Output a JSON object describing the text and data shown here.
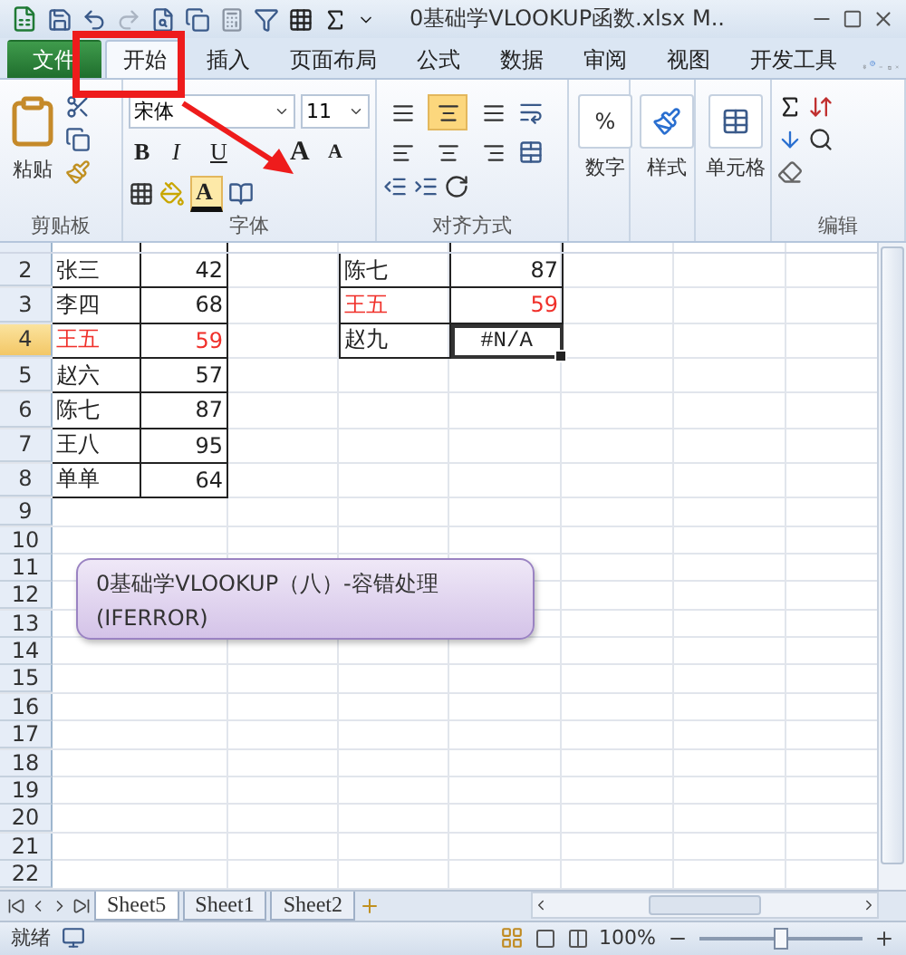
{
  "window": {
    "title": "0基础学VLOOKUP函数.xlsx M.."
  },
  "tabs": [
    {
      "label": "文件",
      "kind": "file",
      "selected": false
    },
    {
      "label": "开始",
      "kind": "tab",
      "selected": true
    },
    {
      "label": "插入",
      "kind": "tab",
      "selected": false
    },
    {
      "label": "页面布局",
      "kind": "tab",
      "selected": false
    },
    {
      "label": "公式",
      "kind": "tab",
      "selected": false
    },
    {
      "label": "数据",
      "kind": "tab",
      "selected": false
    },
    {
      "label": "审阅",
      "kind": "tab",
      "selected": false
    },
    {
      "label": "视图",
      "kind": "tab",
      "selected": false
    },
    {
      "label": "开发工具",
      "kind": "tab",
      "selected": false
    }
  ],
  "ribbon": {
    "clipboard": {
      "paste": "粘贴",
      "label": "剪贴板"
    },
    "font": {
      "font_name": "宋体",
      "font_size": "11",
      "style_buttons": [
        "B",
        "I",
        "U"
      ],
      "size_buttons": [
        "A",
        "A"
      ],
      "font_color": {
        "label": "A",
        "highlighted": true
      },
      "label": "字体"
    },
    "alignment": {
      "buttons": [
        {
          "selected": false
        },
        {
          "selected": true
        },
        {
          "selected": false
        },
        {
          "selected": false
        },
        {
          "selected": false
        },
        {
          "selected": false
        }
      ],
      "label": "对齐方式"
    },
    "number": {
      "button": "数字",
      "symbol": "%"
    },
    "styles": {
      "button": "样式"
    },
    "cells": {
      "button": "单元格"
    },
    "editing": {
      "label": "编辑"
    }
  },
  "grid": {
    "rows": [
      {
        "header": "2",
        "selected": false
      },
      {
        "header": "3",
        "selected": false
      },
      {
        "header": "4",
        "selected": true
      },
      {
        "header": "5",
        "selected": false
      },
      {
        "header": "6",
        "selected": false
      },
      {
        "header": "7",
        "selected": false
      },
      {
        "header": "8",
        "selected": false
      },
      {
        "header": "9",
        "selected": false
      },
      {
        "header": "10",
        "selected": false
      },
      {
        "header": "11",
        "selected": false
      },
      {
        "header": "12",
        "selected": false
      },
      {
        "header": "13",
        "selected": false
      },
      {
        "header": "14",
        "selected": false
      },
      {
        "header": "15",
        "selected": false
      },
      {
        "header": "16",
        "selected": false
      },
      {
        "header": "17",
        "selected": false
      },
      {
        "header": "18",
        "selected": false
      },
      {
        "header": "19",
        "selected": false
      },
      {
        "header": "20",
        "selected": false
      },
      {
        "header": "21",
        "selected": false
      },
      {
        "header": "22",
        "selected": false
      }
    ]
  },
  "table_left": {
    "rows": [
      {
        "name": "张三",
        "score": "42",
        "highlight": false
      },
      {
        "name": "李四",
        "score": "68",
        "highlight": false
      },
      {
        "name": "王五",
        "score": "59",
        "highlight": true
      },
      {
        "name": "赵六",
        "score": "57",
        "highlight": false
      },
      {
        "name": "陈七",
        "score": "87",
        "highlight": false
      },
      {
        "name": "王八",
        "score": "95",
        "highlight": false
      },
      {
        "name": "单单",
        "score": "64",
        "highlight": false
      }
    ]
  },
  "table_right": {
    "rows": [
      {
        "name": "陈七",
        "value": "87",
        "highlight": false,
        "active": false
      },
      {
        "name": "王五",
        "value": "59",
        "highlight": true,
        "active": false
      },
      {
        "name": "赵九",
        "value": "#N/A",
        "highlight": false,
        "active": true
      }
    ]
  },
  "text_box": {
    "lines": [
      "0基础学VLOOKUP（八）-容错处理",
      "(IFERROR)"
    ]
  },
  "sheet_tabs": [
    {
      "label": "Sheet5",
      "selected": true
    },
    {
      "label": "Sheet1",
      "selected": false
    },
    {
      "label": "Sheet2",
      "selected": false
    }
  ],
  "status_bar": {
    "status": "就绪",
    "zoom": "100%",
    "level": 0.5
  }
}
